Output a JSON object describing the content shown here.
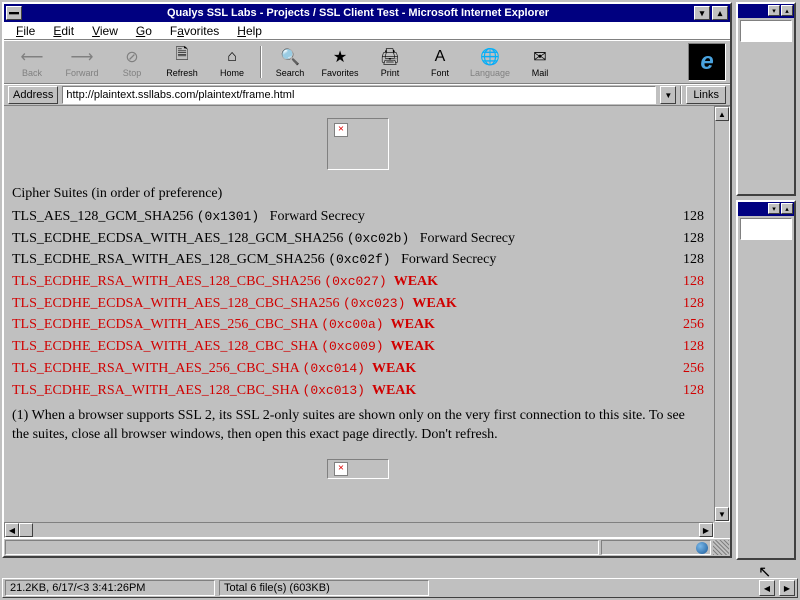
{
  "window": {
    "title": "Qualys SSL Labs - Projects / SSL Client Test - Microsoft Internet Explorer"
  },
  "menu": {
    "file": "File",
    "edit": "Edit",
    "view": "View",
    "go": "Go",
    "favorites": "Favorites",
    "help": "Help"
  },
  "toolbar": {
    "back": "Back",
    "forward": "Forward",
    "stop": "Stop",
    "refresh": "Refresh",
    "home": "Home",
    "search": "Search",
    "favorites": "Favorites",
    "print": "Print",
    "font": "Font",
    "language": "Language",
    "mail": "Mail"
  },
  "address": {
    "label": "Address",
    "url": "http://plaintext.ssllabs.com/plaintext/frame.html",
    "links": "Links"
  },
  "page": {
    "heading": "Cipher Suites (in order of preference)",
    "rows": [
      {
        "name": "TLS_AES_128_GCM_SHA256",
        "hex": "(0x1301)",
        "tag": "Forward Secrecy",
        "bits": "128",
        "weak": false
      },
      {
        "name": "TLS_ECDHE_ECDSA_WITH_AES_128_GCM_SHA256",
        "hex": "(0xc02b)",
        "tag": "Forward Secrecy",
        "bits": "128",
        "weak": false
      },
      {
        "name": "TLS_ECDHE_RSA_WITH_AES_128_GCM_SHA256",
        "hex": "(0xc02f)",
        "tag": "Forward Secrecy",
        "bits": "128",
        "weak": false
      },
      {
        "name": "TLS_ECDHE_RSA_WITH_AES_128_CBC_SHA256",
        "hex": "(0xc027)",
        "tag": "WEAK",
        "bits": "128",
        "weak": true
      },
      {
        "name": "TLS_ECDHE_ECDSA_WITH_AES_128_CBC_SHA256",
        "hex": "(0xc023)",
        "tag": "WEAK",
        "bits": "128",
        "weak": true
      },
      {
        "name": "TLS_ECDHE_ECDSA_WITH_AES_256_CBC_SHA",
        "hex": "(0xc00a)",
        "tag": "WEAK",
        "bits": "256",
        "weak": true
      },
      {
        "name": "TLS_ECDHE_ECDSA_WITH_AES_128_CBC_SHA",
        "hex": "(0xc009)",
        "tag": "WEAK",
        "bits": "128",
        "weak": true
      },
      {
        "name": "TLS_ECDHE_RSA_WITH_AES_256_CBC_SHA",
        "hex": "(0xc014)",
        "tag": "WEAK",
        "bits": "256",
        "weak": true
      },
      {
        "name": "TLS_ECDHE_RSA_WITH_AES_128_CBC_SHA",
        "hex": "(0xc013)",
        "tag": "WEAK",
        "bits": "128",
        "weak": true
      }
    ],
    "footnote": "(1) When a browser supports SSL 2, its SSL 2-only suites are shown only on the very first connection to this site. To see the suites, close all browser windows, then open this exact page directly. Don't refresh."
  },
  "taskbar": {
    "left": "21.2KB, 6/17/<3 3:41:26PM",
    "right": "Total 6 file(s) (603KB)"
  }
}
